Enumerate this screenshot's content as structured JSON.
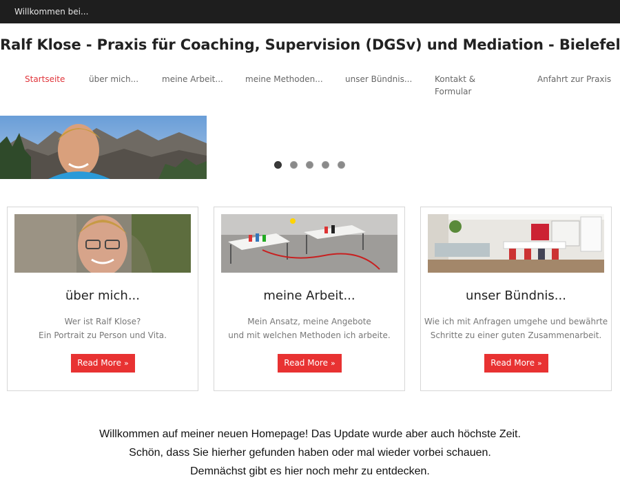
{
  "topbar": {
    "text": "Willkommen bei..."
  },
  "header": {
    "site_title": "Ralf Klose - Praxis für Coaching, Supervision (DGSv) und Mediation - Bielefeld"
  },
  "nav": {
    "items": [
      {
        "label": "Startseite",
        "active": true
      },
      {
        "label": "über mich...",
        "active": false
      },
      {
        "label": "meine Arbeit...",
        "active": false
      },
      {
        "label": "meine Methoden...",
        "active": false
      },
      {
        "label": "unser Bündnis...",
        "active": false
      },
      {
        "label": "Kontakt &",
        "label2": "Formular",
        "active": false
      },
      {
        "label": "Anfahrt zur Praxis",
        "active": false
      }
    ]
  },
  "slider": {
    "slide_count": 5,
    "active_index": 0
  },
  "cards": [
    {
      "title": "über mich...",
      "line1": "Wer ist Ralf Klose?",
      "line2": "Ein Portrait zu Person und Vita.",
      "button": "Read More"
    },
    {
      "title": "meine Arbeit...",
      "line1": "Mein Ansatz, meine Angebote",
      "line2": "und mit welchen Methoden ich arbeite.",
      "button": "Read More"
    },
    {
      "title": "unser Bündnis...",
      "line1": "Wie ich mit Anfragen umgehe und bewährte",
      "line2": "Schritte zu einer guten Zusammenarbeit.",
      "button": "Read More"
    }
  ],
  "welcome": {
    "line1": "Willkommen auf meiner neuen Homepage! Das Update wurde aber auch höchste Zeit.",
    "line2": "Schön, dass Sie hierher gefunden haben oder mal wieder vorbei schauen.",
    "line3": "Demnächst gibt es hier noch mehr zu entdecken."
  },
  "colors": {
    "accent": "#e83232",
    "nav_active": "#e0343a",
    "topbar_bg": "#1e1e1e"
  },
  "icons": {
    "button_chevron": "double-chevron-right-icon"
  }
}
